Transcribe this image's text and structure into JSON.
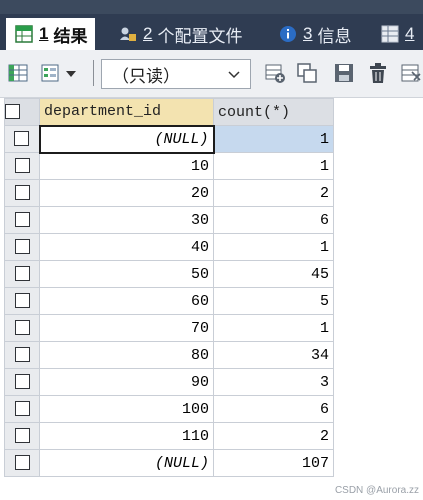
{
  "tabs": [
    {
      "num": "1",
      "label": "结果",
      "icon": "results-grid-icon",
      "active": true
    },
    {
      "num": "2",
      "label": "个配置文件",
      "icon": "profile-icon",
      "active": false
    },
    {
      "num": "3",
      "label": "信息",
      "icon": "info-icon",
      "active": false
    },
    {
      "num": "4",
      "label": "",
      "icon": "table-icon",
      "active": false
    }
  ],
  "toolbar": {
    "mode_value": "（只读）",
    "icons": [
      "grid-view-icon",
      "form-view-icon",
      "dropdown-arrow-icon",
      "add-row-icon",
      "duplicate-row-icon",
      "save-icon",
      "delete-icon",
      "export-icon"
    ]
  },
  "grid": {
    "columns": [
      "department_id",
      "count(*)"
    ],
    "rows": [
      {
        "department_id": "(NULL)",
        "count": "1",
        "null": true,
        "selected": true
      },
      {
        "department_id": "10",
        "count": "1"
      },
      {
        "department_id": "20",
        "count": "2"
      },
      {
        "department_id": "30",
        "count": "6"
      },
      {
        "department_id": "40",
        "count": "1"
      },
      {
        "department_id": "50",
        "count": "45"
      },
      {
        "department_id": "60",
        "count": "5"
      },
      {
        "department_id": "70",
        "count": "1"
      },
      {
        "department_id": "80",
        "count": "34"
      },
      {
        "department_id": "90",
        "count": "3"
      },
      {
        "department_id": "100",
        "count": "6"
      },
      {
        "department_id": "110",
        "count": "2"
      },
      {
        "department_id": "(NULL)",
        "count": "107",
        "null": true
      }
    ]
  },
  "watermark": "CSDN @Aurora.zz",
  "colors": {
    "tab_bar": "#2f3c52",
    "toolbar": "#eef0f3",
    "header_highlight": "#f3e3b0",
    "selection": "#c6d9ee"
  }
}
